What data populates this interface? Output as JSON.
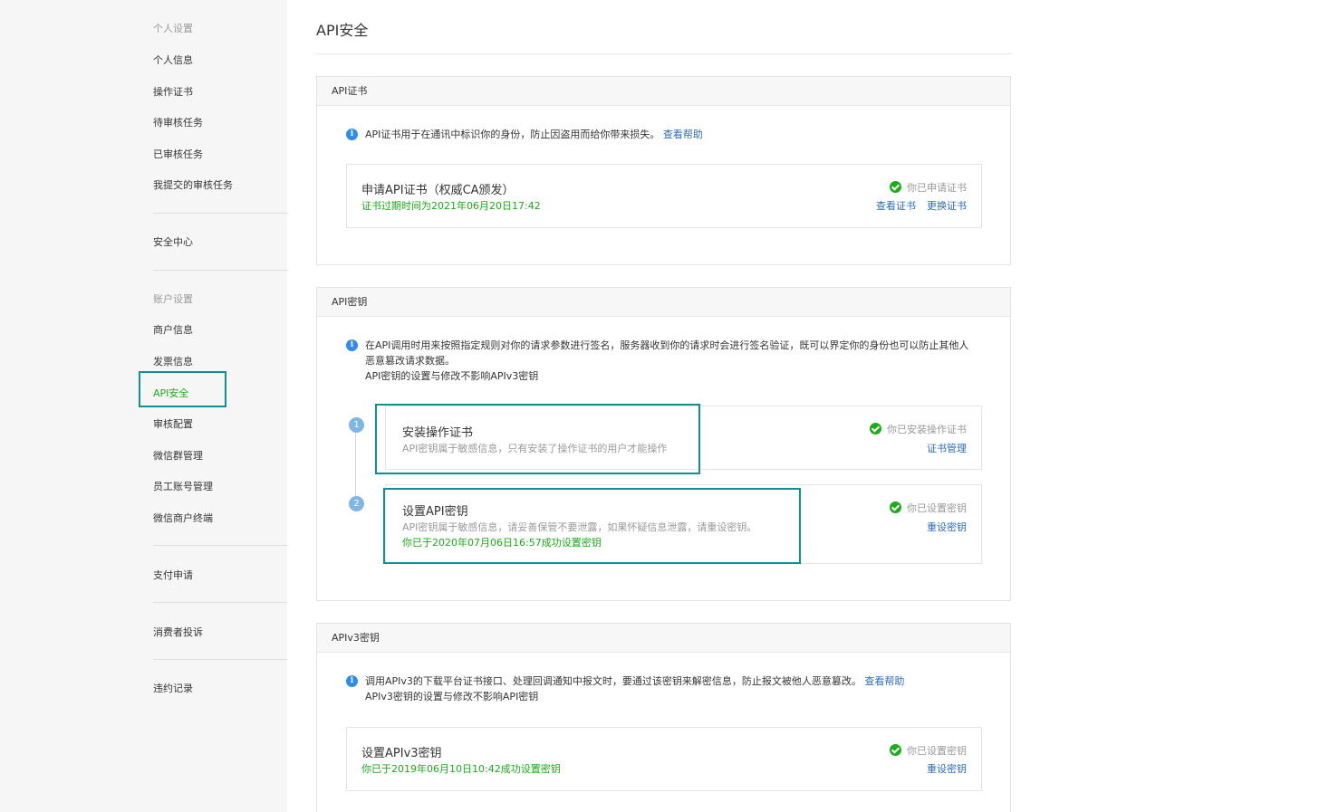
{
  "sidebar": {
    "group1_title": "个人设置",
    "group1_items": [
      "个人信息",
      "操作证书",
      "待审核任务",
      "已审核任务",
      "我提交的审核任务"
    ],
    "security_center": "安全中心",
    "group2_title": "账户设置",
    "group2_items": [
      "商户信息",
      "发票信息",
      "API安全",
      "审核配置",
      "微信群管理",
      "员工账号管理",
      "微信商户终端"
    ],
    "pay_apply": "支付申请",
    "complaint": "消费者投诉",
    "violation": "违约记录"
  },
  "page_title": "API安全",
  "cert_section": {
    "header": "API证书",
    "info": "API证书用于在通讯中标识你的身份，防止因盗用而给你带来损失。",
    "help": "查看帮助",
    "card": {
      "title": "申请API证书（权威CA颁发）",
      "sub": "证书过期时间为2021年06月20日17:42",
      "status": "你已申请证书",
      "action1": "查看证书",
      "action2": "更换证书"
    }
  },
  "key_section": {
    "header": "API密钥",
    "info_line1": "在API调用时用来按照指定规则对你的请求参数进行签名，服务器收到你的请求时会进行签名验证，既可以界定你的身份也可以防止其他人",
    "info_line2": "恶意篡改请求数据。",
    "info_line3": "API密钥的设置与修改不影响APIv3密钥",
    "step1": {
      "num": "1",
      "title": "安装操作证书",
      "sub": "API密钥属于敏感信息，只有安装了操作证书的用户才能操作",
      "status": "你已安装操作证书",
      "action": "证书管理"
    },
    "step2": {
      "num": "2",
      "title": "设置API密钥",
      "sub": "API密钥属于敏感信息，请妥善保管不要泄露，如果怀疑信息泄露，请重设密钥。",
      "sub2": "你已于2020年07月06日16:57成功设置密钥",
      "status": "你已设置密钥",
      "action": "重设密钥"
    }
  },
  "v3_section": {
    "header": "APIv3密钥",
    "info_line1": "调用APIv3的下载平台证书接口、处理回调通知中报文时，要通过该密钥来解密信息，防止报文被他人恶意篡改。",
    "help": "查看帮助",
    "info_line2": "APIv3密钥的设置与修改不影响API密钥",
    "card": {
      "title": "设置APIv3密钥",
      "sub": "你已于2019年06月10日10:42成功设置密钥",
      "status": "你已设置密钥",
      "action": "重设密钥"
    }
  }
}
